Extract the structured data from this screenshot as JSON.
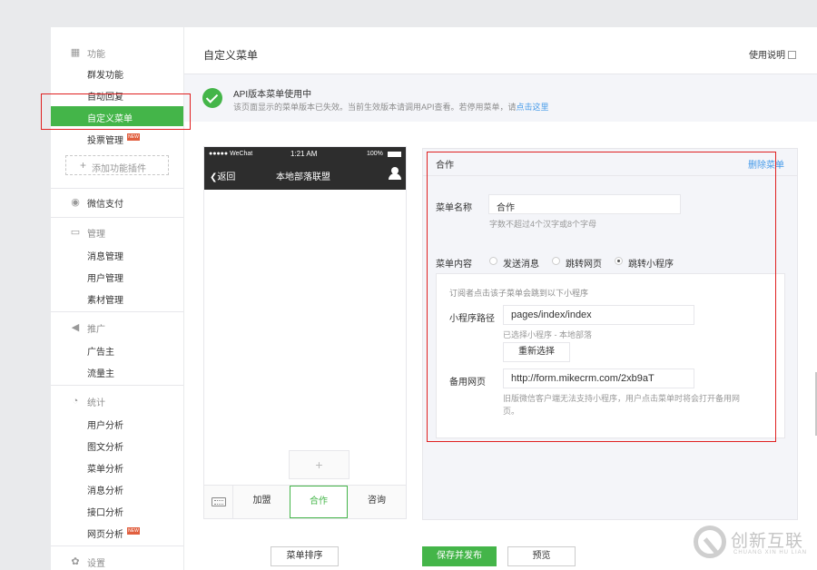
{
  "sidebar": {
    "groups": {
      "function": "功能",
      "pay": "微信支付",
      "manage": "管理",
      "promote": "推广",
      "stats": "统计",
      "settings": "设置"
    },
    "items": {
      "mass_send": "群发功能",
      "auto_reply": "自动回复",
      "custom_menu": "自定义菜单",
      "vote": "投票管理",
      "add_plugin": "添加功能插件",
      "messages": "消息管理",
      "users": "用户管理",
      "materials": "素材管理",
      "advertiser": "广告主",
      "traffic_owner": "流量主",
      "user_analysis": "用户分析",
      "article_analysis": "图文分析",
      "menu_analysis": "菜单分析",
      "message_analysis": "消息分析",
      "api_analysis": "接口分析",
      "web_analysis": "网页分析"
    },
    "new_badge": "NEW"
  },
  "header": {
    "title": "自定义菜单",
    "help": "使用说明"
  },
  "notice": {
    "title": "API版本菜单使用中",
    "desc": "该页面显示的菜单版本已失效。当前生效版本请调用API查看。若停用菜单，请",
    "link": "点击这里"
  },
  "phone": {
    "carrier": "●●●●● WeChat",
    "time": "1:21 AM",
    "battery": "100%",
    "back": "返回",
    "title": "本地部落联盟",
    "add_sub": "+",
    "tabs": [
      "加盟",
      "合作",
      "咨询"
    ]
  },
  "editor": {
    "menu_name": "合作",
    "delete": "删除菜单",
    "name_label": "菜单名称",
    "name_value": "合作",
    "name_hint": "字数不超过4个汉字或8个字母",
    "content_label": "菜单内容",
    "radio_options": [
      "发送消息",
      "跳转网页",
      "跳转小程序"
    ],
    "selected_option": "跳转小程序",
    "mini_desc": "订阅者点击该子菜单会跳到以下小程序",
    "path_label": "小程序路径",
    "path_value": "pages/index/index",
    "selected_hint": "已选择小程序 - 本地部落",
    "reselect": "重新选择",
    "backup_label": "备用网页",
    "backup_value": "http://form.mikecrm.com/2xb9aT",
    "backup_hint_1": "旧版微信客户端无法支持小程序，用户点击菜单时将会打开备用网",
    "backup_hint_2": "页。"
  },
  "footer": {
    "sort": "菜单排序",
    "save_publish": "保存并发布",
    "preview": "预览"
  },
  "watermark": {
    "cn": "创新互联",
    "en": "CHUANG XIN HU LIAN"
  },
  "colors": {
    "accent": "#44b549",
    "link": "#459ae9",
    "highlight": "#e02020"
  }
}
